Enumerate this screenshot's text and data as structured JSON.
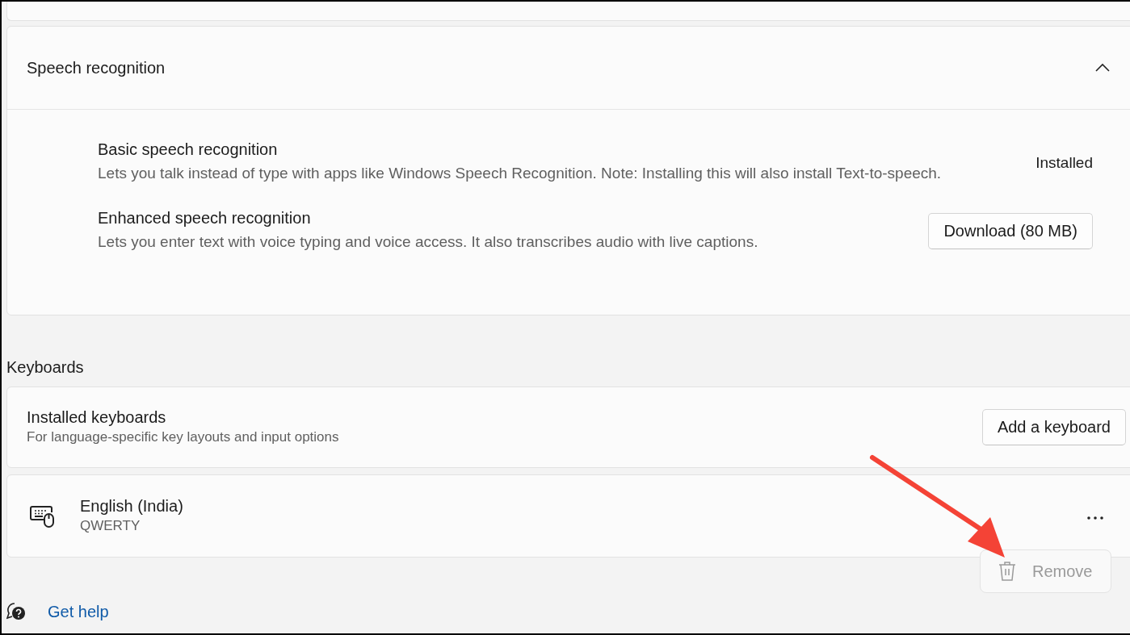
{
  "speech_recognition": {
    "title": "Speech recognition",
    "expanded": true,
    "items": [
      {
        "kind": "status",
        "title": "Basic speech recognition",
        "description": "Lets you talk instead of type with apps like Windows Speech Recognition. Note: Installing this will also install Text-to-speech.",
        "status": "Installed"
      },
      {
        "kind": "button",
        "title": "Enhanced speech recognition",
        "description": "Lets you enter text with voice typing and voice access. It also transcribes audio with live captions.",
        "button": "Download (80 MB)"
      }
    ]
  },
  "keyboards": {
    "heading": "Keyboards",
    "installed": {
      "title": "Installed keyboards",
      "description": "For language-specific key layouts and input options",
      "button": "Add a keyboard"
    },
    "items": [
      {
        "name": "English (India)",
        "layout": "QWERTY"
      }
    ]
  },
  "context_menu": {
    "items": [
      {
        "label": "Remove",
        "disabled": true
      }
    ]
  },
  "help_link": "Get help"
}
